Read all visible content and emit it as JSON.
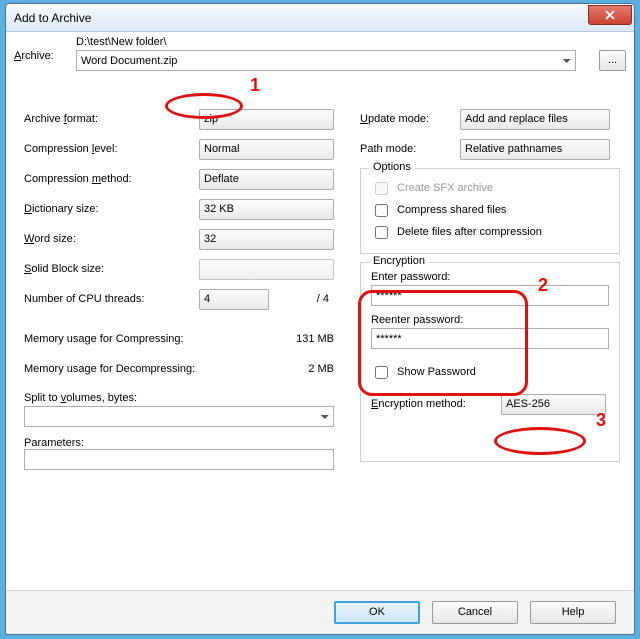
{
  "window": {
    "title": "Add to Archive"
  },
  "archive": {
    "label_html": "Archive:",
    "path": "D:\\test\\New folder\\",
    "filename": "Word Document.zip"
  },
  "left": {
    "format": {
      "label": "Archive format:",
      "value": "zip"
    },
    "level": {
      "label": "Compression level:",
      "value": "Normal"
    },
    "method": {
      "label": "Compression method:",
      "value": "Deflate"
    },
    "dict": {
      "label": "Dictionary size:",
      "value": "32 KB"
    },
    "word": {
      "label": "Word size:",
      "value": "32"
    },
    "solid": {
      "label": "Solid Block size:",
      "value": ""
    },
    "threads": {
      "label": "Number of CPU threads:",
      "value": "4",
      "max": "/ 4"
    },
    "memC": {
      "label": "Memory usage for Compressing:",
      "value": "131 MB"
    },
    "memD": {
      "label": "Memory usage for Decompressing:",
      "value": "2 MB"
    },
    "split": {
      "label": "Split to volumes, bytes:"
    },
    "params": {
      "label": "Parameters:"
    }
  },
  "right": {
    "update": {
      "label": "Update mode:",
      "value": "Add and replace files"
    },
    "path": {
      "label": "Path mode:",
      "value": "Relative pathnames"
    },
    "options": {
      "legend": "Options",
      "sfx": "Create SFX archive",
      "shared": "Compress shared files",
      "del": "Delete files after compression"
    },
    "enc": {
      "legend": "Encryption",
      "enter": "Enter password:",
      "reenter": "Reenter password:",
      "value": "******",
      "show": "Show Password",
      "methodLabel": "Encryption method:",
      "method": "AES-256"
    }
  },
  "buttons": {
    "ok": "OK",
    "cancel": "Cancel",
    "help": "Help"
  },
  "annot": {
    "n1": "1",
    "n2": "2",
    "n3": "3"
  }
}
